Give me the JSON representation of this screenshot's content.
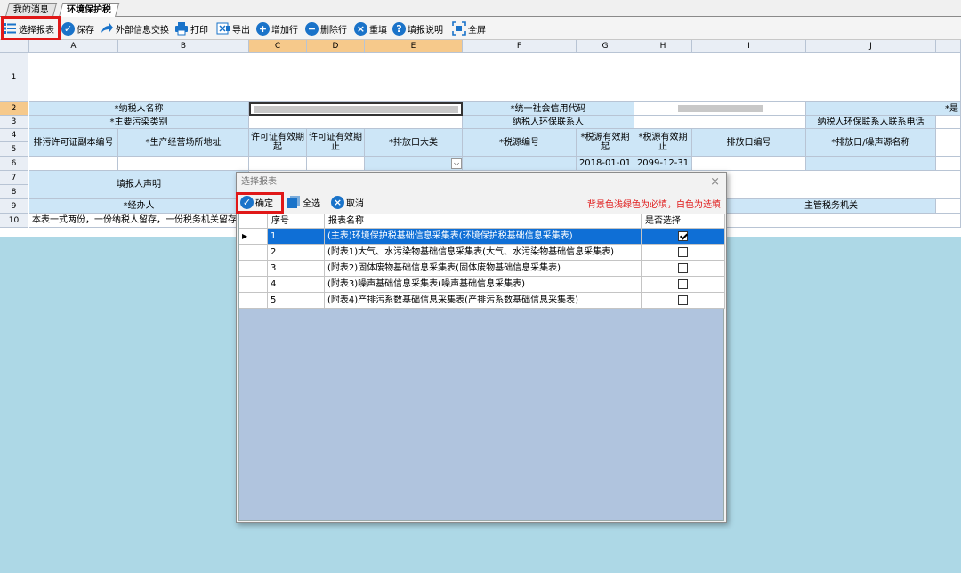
{
  "tabs": [
    "我的消息",
    "环境保护税"
  ],
  "toolbar": [
    {
      "label": "选择报表",
      "icon": "list-icon"
    },
    {
      "label": "保存",
      "icon": "check-circle-icon"
    },
    {
      "label": "外部信息交换",
      "icon": "share-arrow-icon"
    },
    {
      "label": "打印",
      "icon": "printer-icon"
    },
    {
      "label": "导出",
      "icon": "export-icon"
    },
    {
      "label": "增加行",
      "icon": "plus-circle-icon"
    },
    {
      "label": "删除行",
      "icon": "minus-circle-icon"
    },
    {
      "label": "重填",
      "icon": "x-circle-icon"
    },
    {
      "label": "填报说明",
      "icon": "question-circle-icon"
    },
    {
      "label": "全屏",
      "icon": "fullscreen-icon"
    }
  ],
  "sheet": {
    "columns": [
      "A",
      "B",
      "C",
      "D",
      "E",
      "F",
      "G",
      "H",
      "I",
      "J"
    ],
    "rows": [
      "1",
      "2",
      "3",
      "4",
      "5",
      "6",
      "7",
      "8",
      "9",
      "10"
    ],
    "cells": {
      "taxpayer_name": "*纳税人名称",
      "credit_code": "*统一社会信用代码",
      "partial_label": "*是",
      "pollutant_type": "*主要污染类别",
      "env_contact": "纳税人环保联系人",
      "env_contact_phone": "纳税人环保联系人联系电话",
      "permit_no": "排污许可证副本编号",
      "business_address": "*生产经营场所地址",
      "permit_start": "许可证有效期起",
      "permit_end": "许可证有效期止",
      "outlet_category": "*排放口大类",
      "source_no": "*税源编号",
      "source_start": "*税源有效期起",
      "source_end": "*税源有效期止",
      "outlet_no": "排放口编号",
      "outlet_noise_name": "*排放口/噪声源名称",
      "date_start": "2018-01-01",
      "date_end": "2099-12-31",
      "filler_declaration": "填报人声明",
      "handler": "*经办人",
      "tax_authority": "主管税务机关",
      "footer_note": "本表一式两份，一份纳税人留存，一份税务机关留存"
    }
  },
  "dialog": {
    "title": "选择报表",
    "confirm": "确定",
    "select_all": "全选",
    "cancel": "取消",
    "note": "背景色浅绿色为必填，白色为选填",
    "headers": [
      "序号",
      "报表名称",
      "是否选择"
    ],
    "rows": [
      {
        "no": "1",
        "name": "(主表)环境保护税基础信息采集表(环境保护税基础信息采集表)",
        "checked": true
      },
      {
        "no": "2",
        "name": "(附表1)大气、水污染物基础信息采集表(大气、水污染物基础信息采集表)",
        "checked": false
      },
      {
        "no": "3",
        "name": "(附表2)固体废物基础信息采集表(固体废物基础信息采集表)",
        "checked": false
      },
      {
        "no": "4",
        "name": "(附表3)噪声基础信息采集表(噪声基础信息采集表)",
        "checked": false
      },
      {
        "no": "5",
        "name": "(附表4)产排污系数基础信息采集表(产排污系数基础信息采集表)",
        "checked": false
      }
    ]
  },
  "colors": {
    "required_bg": "#cde6f7",
    "selected_row": "#0f6fd6",
    "highlight": "#e01818",
    "workspace": "#add8e6"
  }
}
